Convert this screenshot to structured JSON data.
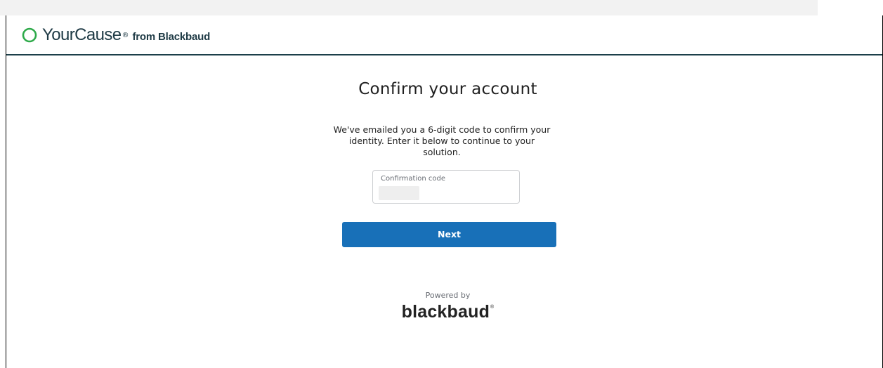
{
  "brand": {
    "name": "YourCause",
    "registered_mark": "®",
    "tagline": "from Blackbaud",
    "ring_color": "#2eaa4a",
    "text_color": "#1e3a45"
  },
  "page": {
    "title": "Confirm your account",
    "description": "We've emailed you a 6-digit code to confirm your identity. Enter it below to continue to your solution."
  },
  "confirmation_field": {
    "label": "Confirmation code",
    "value": ""
  },
  "next_button": {
    "label": "Next",
    "color": "#1870b8"
  },
  "footer": {
    "powered_by": "Powered by",
    "logo_text": "blackbaud",
    "logo_mark": "®"
  }
}
